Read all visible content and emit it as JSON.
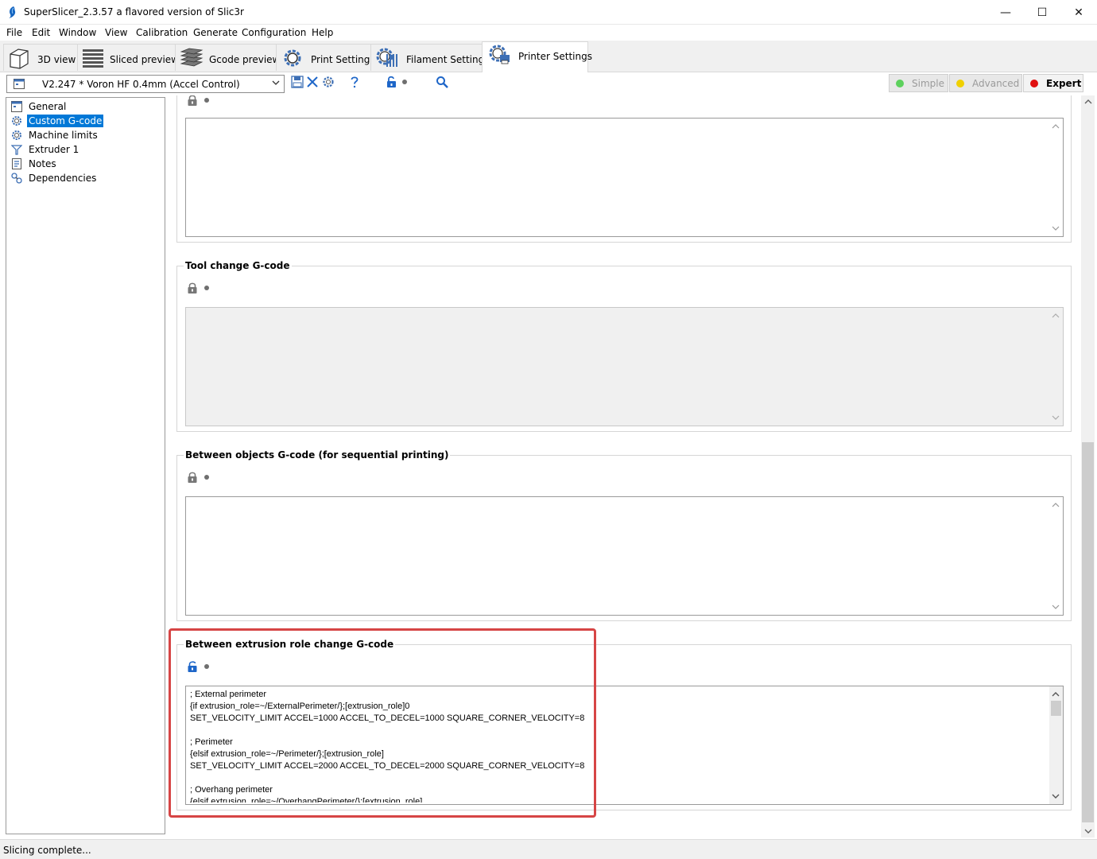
{
  "window": {
    "title": "SuperSlicer_2.3.57 a flavored version of Slic3r",
    "minimize": "—",
    "maximize": "☐",
    "close": "✕"
  },
  "menu": [
    "File",
    "Edit",
    "Window",
    "View",
    "Calibration",
    "Generate",
    "Configuration",
    "Help"
  ],
  "tabs": [
    {
      "label": "3D view",
      "icon": "cube-icon"
    },
    {
      "label": "Sliced preview",
      "icon": "layers-icon"
    },
    {
      "label": "Gcode preview",
      "icon": "stack-icon"
    },
    {
      "label": "Print Settings",
      "icon": "cog-icon"
    },
    {
      "label": "Filament Settings",
      "icon": "spool-icon"
    },
    {
      "label": "Printer Settings",
      "icon": "printer-cog-icon"
    }
  ],
  "active_tab": "Printer Settings",
  "toolbar": {
    "preset": "V2.247 * Voron HF 0.4mm (Accel Control)",
    "modes": [
      {
        "label": "Simple",
        "color": "#5dd15d",
        "enabled": false
      },
      {
        "label": "Advanced",
        "color": "#f0d000",
        "enabled": false
      },
      {
        "label": "Expert",
        "color": "#e01010",
        "enabled": true
      }
    ]
  },
  "sidebar": {
    "items": [
      {
        "label": "General",
        "icon": "window-icon",
        "selected": false
      },
      {
        "label": "Custom G-code",
        "icon": "gear-icon",
        "selected": true
      },
      {
        "label": "Machine limits",
        "icon": "gear-icon",
        "selected": false
      },
      {
        "label": "Extruder 1",
        "icon": "funnel-icon",
        "selected": false
      },
      {
        "label": "Notes",
        "icon": "note-icon",
        "selected": false
      },
      {
        "label": "Dependencies",
        "icon": "dependencies-icon",
        "selected": false
      }
    ]
  },
  "groups": {
    "tool_change": {
      "title": "Tool change G-code"
    },
    "between_objects": {
      "title": "Between objects G-code (for sequential printing)"
    },
    "extrusion_role": {
      "title": "Between extrusion role change G-code",
      "lines": [
        "; External perimeter",
        "{if extrusion_role=~/ExternalPerimeter/};[extrusion_role]0",
        "SET_VELOCITY_LIMIT ACCEL=1000 ACCEL_TO_DECEL=1000 SQUARE_CORNER_VELOCITY=8",
        "",
        "; Perimeter",
        "{elsif extrusion_role=~/Perimeter/};[extrusion_role]",
        "SET_VELOCITY_LIMIT ACCEL=2000 ACCEL_TO_DECEL=2000 SQUARE_CORNER_VELOCITY=8",
        "",
        "; Overhang perimeter",
        "{elsif extrusion_role=~/OverhangPerimeter/};[extrusion_role]"
      ]
    }
  },
  "status": "Slicing complete..."
}
